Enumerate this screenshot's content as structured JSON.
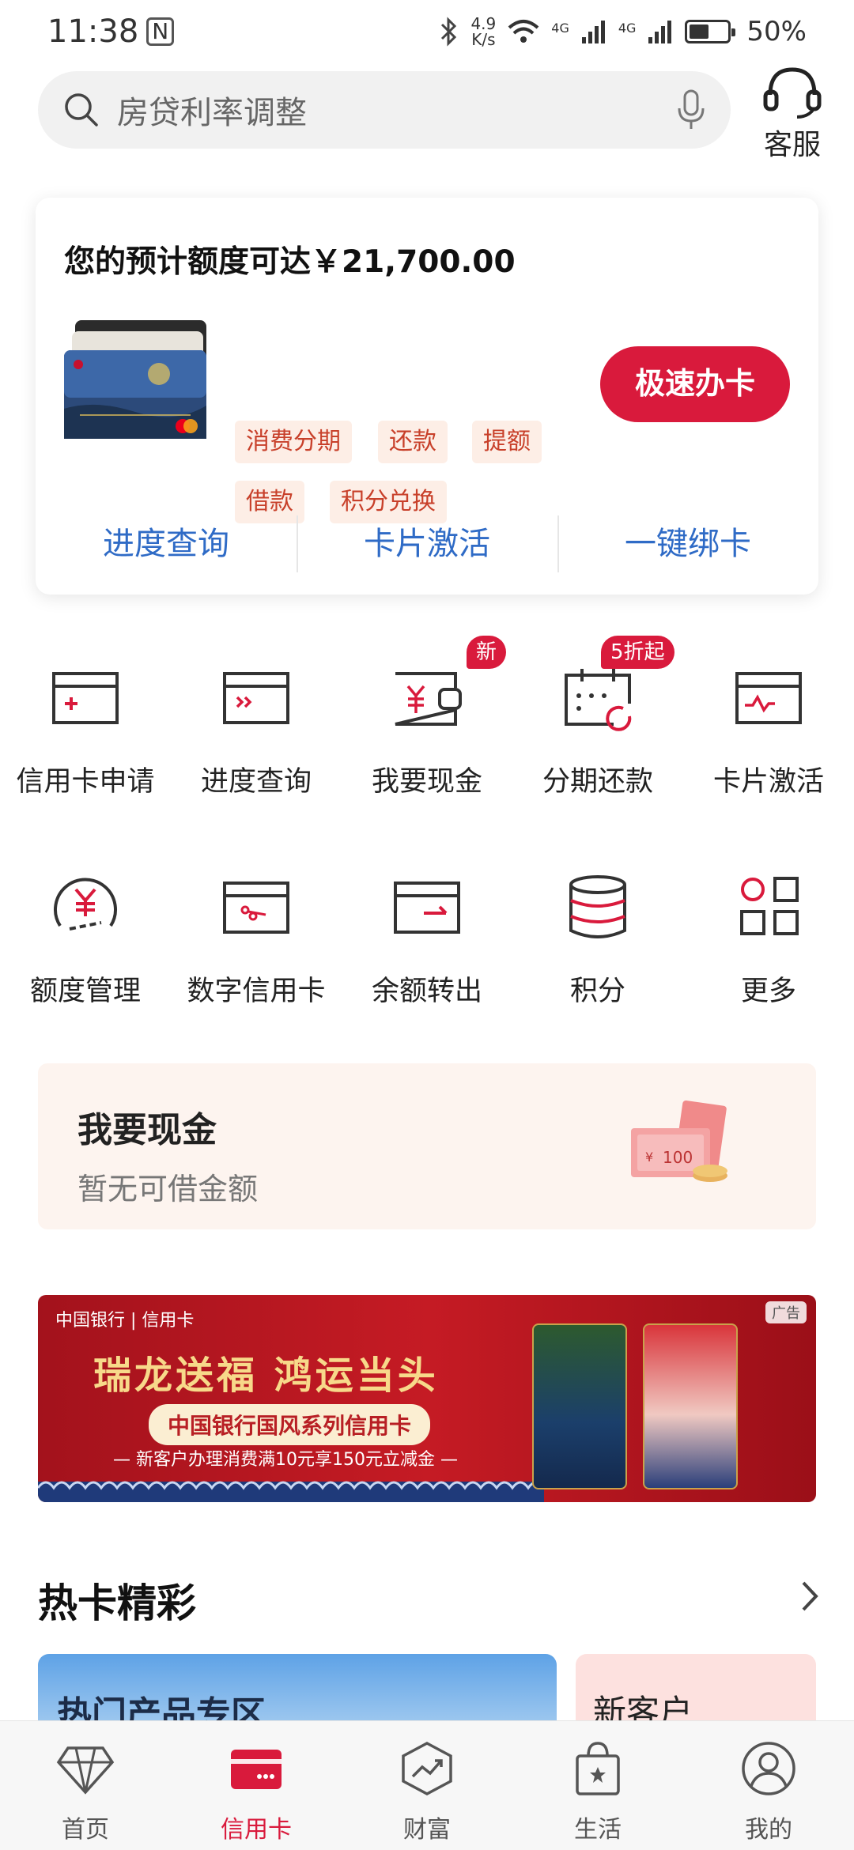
{
  "status_bar": {
    "time": "11:38",
    "nfc": "N",
    "speed_value": "4.9",
    "speed_unit": "K/s",
    "network_1": "4G",
    "network_2": "4G",
    "battery": "50%",
    "battery_level": 0.5
  },
  "search": {
    "placeholder": "房贷利率调整",
    "service_label": "客服"
  },
  "credit_panel": {
    "limit_text": "您的预计额度可达￥21,700.00",
    "tags": [
      "消费分期",
      "还款",
      "提额",
      "借款",
      "积分兑换"
    ],
    "apply_button": "极速办卡",
    "links": [
      "进度查询",
      "卡片激活",
      "一键绑卡"
    ]
  },
  "services": {
    "row1": [
      {
        "label": "信用卡申请",
        "icon": "card-plus-icon"
      },
      {
        "label": "进度查询",
        "icon": "card-progress-icon"
      },
      {
        "label": "我要现金",
        "icon": "wallet-yuan-icon",
        "badge": "新"
      },
      {
        "label": "分期还款",
        "icon": "calendar-refresh-icon",
        "badge": "5折起"
      },
      {
        "label": "卡片激活",
        "icon": "card-activate-icon"
      }
    ],
    "row2": [
      {
        "label": "额度管理",
        "icon": "yuan-gauge-icon"
      },
      {
        "label": "数字信用卡",
        "icon": "digital-card-icon"
      },
      {
        "label": "余额转出",
        "icon": "card-transfer-icon"
      },
      {
        "label": "积分",
        "icon": "coin-stack-icon"
      },
      {
        "label": "更多",
        "icon": "grid-more-icon"
      }
    ]
  },
  "cash_card": {
    "title": "我要现金",
    "subtitle": "暂无可借金额",
    "note_value": "100",
    "note_symbol": "¥"
  },
  "banner": {
    "bank_name": "中国银行 | 信用卡",
    "ad_label": "广告",
    "headline": "瑞龙送福 鸿运当头",
    "pill": "中国银行国风系列信用卡",
    "sub": "— 新客户办理消费满10元享150元立减金 —"
  },
  "hot": {
    "title": "热卡精彩",
    "card1": "热门产品专区",
    "card2": "新客户"
  },
  "bottom_nav": {
    "items": [
      {
        "label": "首页",
        "icon": "diamond-icon"
      },
      {
        "label": "信用卡",
        "icon": "credit-card-icon",
        "active": true
      },
      {
        "label": "财富",
        "icon": "wealth-chart-icon"
      },
      {
        "label": "生活",
        "icon": "shopping-bag-icon"
      },
      {
        "label": "我的",
        "icon": "user-icon"
      }
    ]
  },
  "colors": {
    "accent": "#d91a3c",
    "link": "#2f6bc6",
    "tag_bg": "#fdeee6",
    "tag_text": "#c8402a"
  }
}
